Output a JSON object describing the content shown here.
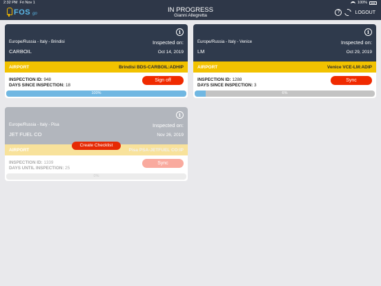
{
  "status_bar": {
    "time": "2:32 PM",
    "date": "Fri Nov 1",
    "battery": "100%"
  },
  "header": {
    "logo_text": "FOS",
    "logo_sub": "go",
    "title": "IN PROGRESS",
    "subtitle": "Gianni Allegretta",
    "help_glyph": "?",
    "logout_label": "LOGOUT"
  },
  "cards": [
    {
      "location": "Europe/Russia - Italy - Brindisi",
      "name": "CARBOIL",
      "inspected_label": "Inspected on:",
      "inspected_date": "Oct 14, 2019",
      "type": "AIRPORT",
      "code": "Brindisi BDS-CARBOIL:ADHIP",
      "id_label": "INSPECTION ID:",
      "id_value": "948",
      "days_label": "DAYS SINCE INSPECTION:",
      "days_value": "18",
      "button": "Sign off",
      "progress_label": "100%",
      "progress_value": 1.0
    },
    {
      "location": "Europe/Russia - Italy - Venice",
      "name": "LM",
      "inspected_label": "Inspected on:",
      "inspected_date": "Oct 29, 2019",
      "type": "AIRPORT",
      "code": "Venice VCE-LM:ADIP",
      "id_label": "INSPECTION ID:",
      "id_value": "1288",
      "days_label": "DAYS SINCE INSPECTION:",
      "days_value": "3",
      "button": "Sync",
      "progress_label": "6%",
      "progress_value": 0.06
    },
    {
      "location": "Europe/Russia - Italy - Pisa",
      "name": "JET FUEL CO",
      "inspected_label": "Inspected on:",
      "inspected_date": "Nov 26, 2019",
      "type": "AIRPORT",
      "code": "Pisa PSA-JETFUEL CO:IP",
      "id_label": "INSPECTION ID:",
      "id_value": "1339",
      "days_label": "DAYS UNTIL INSPECTION:",
      "days_value": "25",
      "button": "Sync",
      "progress_label": "0%",
      "progress_value": 0.0
    }
  ],
  "create_checklist_label": "Create Checklist",
  "colors": {
    "header": "#2e3748",
    "accent": "#f2c200",
    "button": "#f02a00",
    "progress": "#70b7e2"
  }
}
